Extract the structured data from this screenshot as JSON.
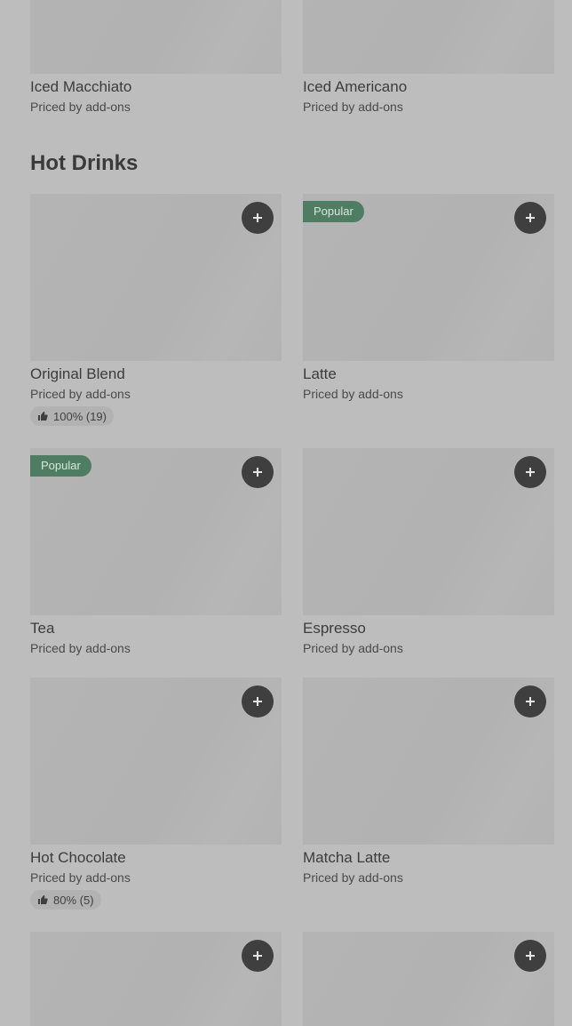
{
  "top_row": [
    {
      "name": "Iced Macchiato",
      "price": "Priced by add-ons"
    },
    {
      "name": "Iced Americano",
      "price": "Priced by add-ons"
    }
  ],
  "section": {
    "title": "Hot Drinks"
  },
  "items": [
    {
      "name": "Original Blend",
      "price": "Priced by add-ons",
      "rating": "100% (19)"
    },
    {
      "name": "Latte",
      "price": "Priced by add-ons",
      "badge": "Popular"
    },
    {
      "name": "Tea",
      "price": "Priced by add-ons",
      "badge": "Popular"
    },
    {
      "name": "Espresso",
      "price": "Priced by add-ons"
    },
    {
      "name": "Hot Chocolate",
      "price": "Priced by add-ons",
      "rating": "80% (5)"
    },
    {
      "name": "Matcha Latte",
      "price": "Priced by add-ons"
    }
  ],
  "icons": {
    "add": "plus-icon",
    "rating": "thumbs-up-icon"
  },
  "colors": {
    "background": "#bdbdbd",
    "badge": "#4e7d63",
    "button": "#3f3f3f"
  }
}
